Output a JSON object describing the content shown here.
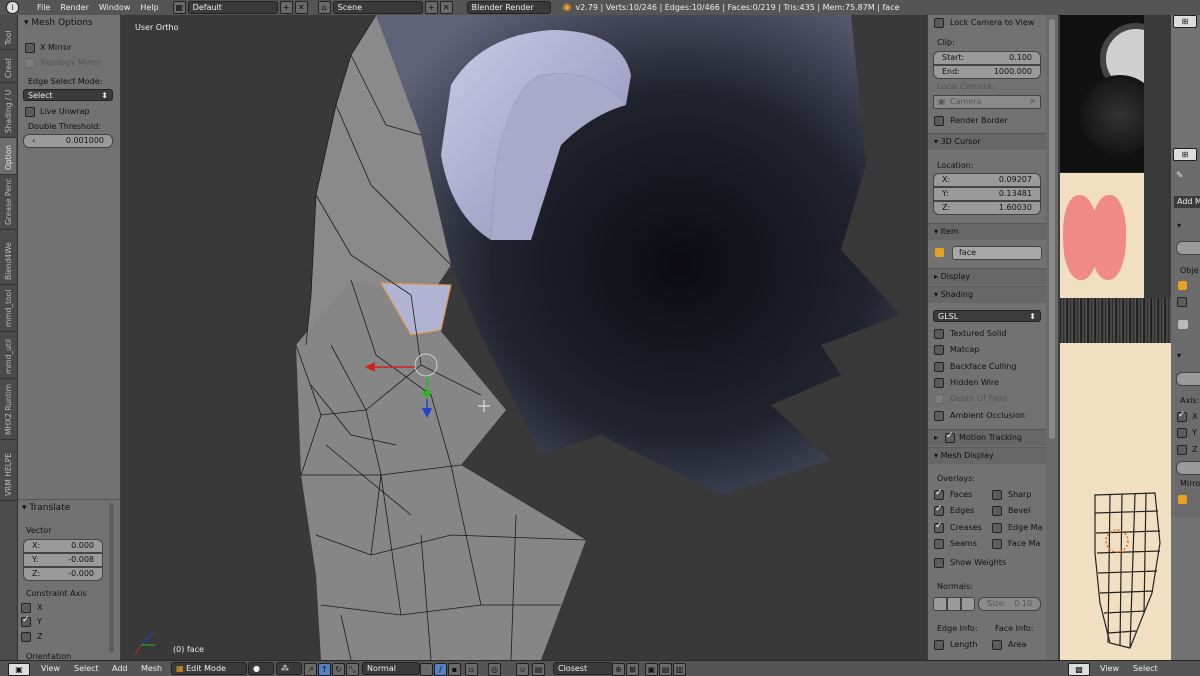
{
  "topbar": {
    "menus": [
      "File",
      "Render",
      "Window",
      "Help"
    ],
    "layout": "Default",
    "scene": "Scene",
    "engine": "Blender Render",
    "stats": "v2.79 | Verts:10/246 | Edges:10/466 | Faces:0/219 | Tris:435 | Mem:75.87M | face"
  },
  "tabs": [
    "Tool",
    "Creat",
    "Shading / U",
    "Option",
    "Grease Penc",
    "Blend4We",
    "mmd_tool",
    "mmd_util",
    "MHX2 Runtim",
    "VRM HELPE"
  ],
  "tool_panel": {
    "mesh_options": "Mesh Options",
    "x_mirror": "X Mirror",
    "topology_mirror": "Topology Mirror",
    "edge_select_mode": "Edge Select Mode:",
    "select": "Select",
    "live_unwrap": "Live Unwrap",
    "double_threshold": "Double Threshold:",
    "threshold_value": "0.001000",
    "translate": "Translate",
    "vector": "Vector",
    "vx_label": "X:",
    "vx": "0.000",
    "vy_label": "Y:",
    "vy": "-0.008",
    "vz_label": "Z:",
    "vz": "-0.000",
    "constraint_axis": "Constraint Axis",
    "ax": "X",
    "ay": "Y",
    "az": "Z",
    "orientation": "Orientation"
  },
  "viewport": {
    "view_label": "User Ortho",
    "object_label": "(0) face"
  },
  "props": {
    "lock_camera": "Lock Camera to View",
    "clip": "Clip:",
    "start_label": "Start:",
    "start": "0.100",
    "end_label": "End:",
    "end": "1000.000",
    "local_camera": "Local Camera:",
    "camera": "Camera",
    "render_border": "Render Border",
    "cursor_3d": "3D Cursor",
    "location": "Location:",
    "cx_label": "X:",
    "cx": "0.09207",
    "cy_label": "Y:",
    "cy": "0.13481",
    "cz_label": "Z:",
    "cz": "1.60030",
    "item": "Item",
    "item_name": "face",
    "display": "Display",
    "shading": "Shading",
    "glsl": "GLSL",
    "textured_solid": "Textured Solid",
    "matcap": "Matcap",
    "backface_culling": "Backface Culling",
    "hidden_wire": "Hidden Wire",
    "depth_of_field": "Depth Of Field",
    "ambient_occlusion": "Ambient Occlusion",
    "motion_tracking": "Motion Tracking",
    "mesh_display": "Mesh Display",
    "overlays": "Overlays:",
    "faces": "Faces",
    "sharp": "Sharp",
    "edges": "Edges",
    "bevel": "Bevel",
    "creases": "Creases",
    "edge_ma": "Edge Ma",
    "seams": "Seams",
    "face_ma": "Face Ma",
    "show_weights": "Show Weights",
    "normals": "Normals:",
    "size_label": "Size:",
    "size": "0.10",
    "edge_info": "Edge Info:",
    "face_info": "Face Info:",
    "length": "Length",
    "area": "Area"
  },
  "rightmost": {
    "add": "Add M",
    "obj": "Obje",
    "axis": "Axis:",
    "x": "X",
    "y": "Y",
    "z": "Z",
    "mirr": "Mirro"
  },
  "bottombar": {
    "view": "View",
    "select": "Select",
    "add": "Add",
    "mesh": "Mesh",
    "mode": "Edit Mode",
    "pivot": "Normal",
    "snap": "Closest",
    "view2": "View",
    "select2": "Select"
  },
  "colors": {
    "panel": "#727272",
    "viewport": "#393939",
    "x_axis": "#d42020",
    "y_axis": "#22bb22",
    "z_axis": "#2040d0",
    "skin": "#f1dfc2",
    "blush": "#f08a86"
  }
}
